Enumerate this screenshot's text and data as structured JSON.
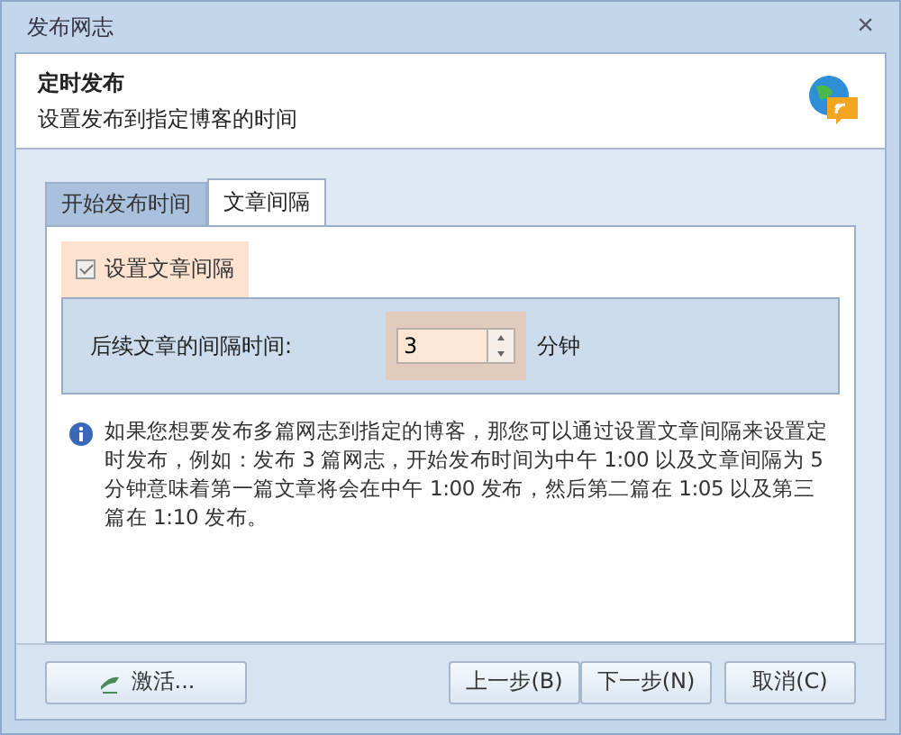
{
  "window": {
    "title": "发布网志",
    "close": "×"
  },
  "header": {
    "title": "定时发布",
    "subtitle": "设置发布到指定博客的时间"
  },
  "tabs": [
    {
      "label": "开始发布时间",
      "selected": false
    },
    {
      "label": "文章间隔",
      "selected": true
    }
  ],
  "interval": {
    "checkbox": {
      "label": "设置文章间隔",
      "checked": true
    },
    "label": "后续文章的间隔时间:",
    "value": "3",
    "unit": "分钟"
  },
  "info": "如果您想要发布多篇网志到指定的博客，那您可以通过设置文章间隔来设置定时发布，例如：发布 3 篇网志，开始发布时间为中午 1:00 以及文章间隔为 5 分钟意味着第一篇文章将会在中午 1:00 发布，然后第二篇在 1:05 以及第三篇在 1:10 发布。",
  "activate_button": "激活...",
  "buttons": [
    "上一步(B)",
    "下一步(N)",
    "取消(C)"
  ]
}
